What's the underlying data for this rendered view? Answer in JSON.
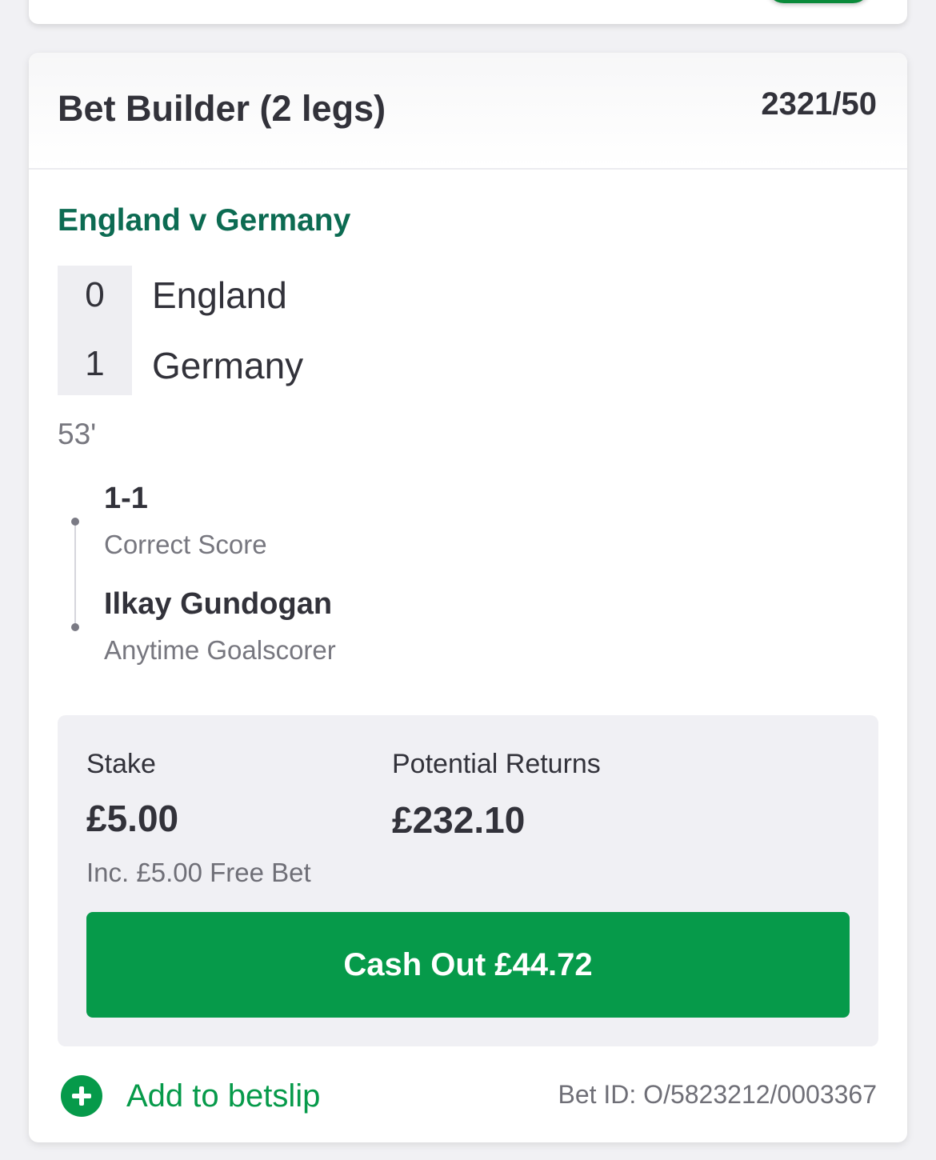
{
  "bet": {
    "title": "Bet Builder (2 legs)",
    "odds": "2321/50"
  },
  "match": {
    "name": "England v Germany",
    "home_score": "0",
    "home_team": "England",
    "away_score": "1",
    "away_team": "Germany",
    "time": "53'"
  },
  "legs": [
    {
      "selection": "1-1",
      "market": "Correct Score"
    },
    {
      "selection": "Ilkay Gundogan",
      "market": "Anytime Goalscorer"
    }
  ],
  "summary": {
    "stake_label": "Stake",
    "stake_value": "£5.00",
    "returns_label": "Potential Returns",
    "returns_value": "£232.10",
    "free_bet_note": "Inc. £5.00 Free Bet",
    "cashout_label": "Cash Out £44.72"
  },
  "footer": {
    "add_betslip_label": "Add to betslip",
    "bet_id": "Bet ID: O/5823212/0003367"
  },
  "colors": {
    "accent_green": "#069a4a",
    "match_title_green": "#0c6b52"
  },
  "icons": {
    "add": "plus-circle-icon"
  }
}
